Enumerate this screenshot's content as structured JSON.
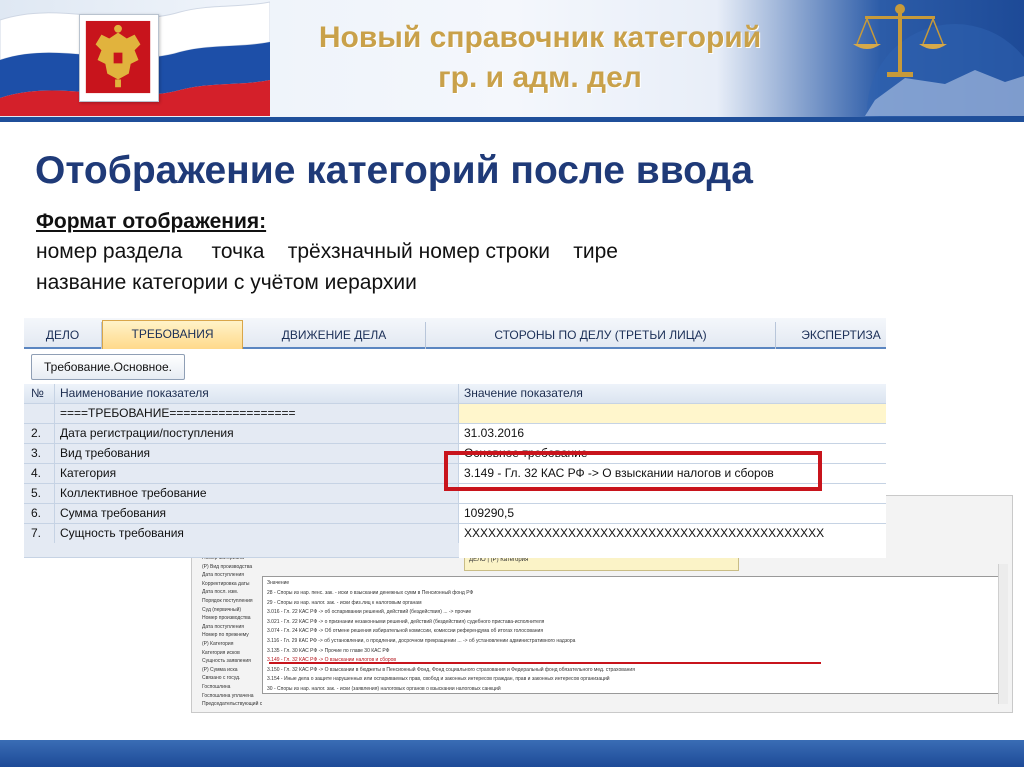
{
  "header": {
    "title_line1": "Новый справочник категорий",
    "title_line2": "гр. и адм. дел"
  },
  "heading": "Отображение категорий после ввода",
  "format": {
    "label": "Формат отображения:",
    "line1": "номер раздела     точка    трёхзначный номер строки    тире",
    "line2": "название категории с учётом иерархии"
  },
  "app": {
    "tabs": [
      {
        "label": "ДЕЛО",
        "active": false
      },
      {
        "label": "ТРЕБОВАНИЯ",
        "active": true
      },
      {
        "label": "ДВИЖЕНИЕ ДЕЛА",
        "active": false
      },
      {
        "label": "СТОРОНЫ ПО ДЕЛУ (ТРЕТЬИ ЛИЦА)",
        "active": false
      },
      {
        "label": "ЭКСПЕРТИЗА",
        "active": false
      }
    ],
    "button_label": "Требование.Основное.",
    "columns": [
      "№",
      "Наименование показателя",
      "Значение показателя"
    ],
    "rows": [
      {
        "num": "",
        "name": "====ТРЕБОВАНИЕ==================",
        "value": ""
      },
      {
        "num": "2.",
        "name": "Дата регистрации/поступления",
        "value": "31.03.2016"
      },
      {
        "num": "3.",
        "name": "Вид требования",
        "value": "Основное требование"
      },
      {
        "num": "4.",
        "name": "Категория",
        "value": "3.149 - Гл. 32 КАС РФ -> О взыскании налогов и сборов"
      },
      {
        "num": "5.",
        "name": "Коллективное требование",
        "value": ""
      },
      {
        "num": "6.",
        "name": "Сумма требования",
        "value": "109290,5"
      },
      {
        "num": "7.",
        "name": "Сущность требования",
        "value": "XXXXXXXXXXXXXXXXXXXXXXXXXXXXXXXXXXXXXXXXXXXXX"
      }
    ]
  },
  "background_window": {
    "left_rows": [
      "Номер материала",
      "(Р) Вид производства",
      "Дата поступления",
      "Корректировка даты",
      "Дата посл. изм.",
      "Порядок поступления",
      "Суд (первичный)",
      "Номер производства",
      "Дата поступления",
      "Номер по прежнему",
      "(Р) Категория",
      "Категория исков",
      "Сущность заявления",
      "(Р) Сумма иска",
      "Связано с госуд.",
      "Госпошлина",
      "Госпошлина уплачена",
      "Председательствующий судья"
    ],
    "top_field": "ДЕЛО | (Р) Категория",
    "dropdown_header": "Значение",
    "dropdown_rows": [
      "28 - Споры из нар. пенс. зак. - иски о взыскании денежных сумм в Пенсионный фонд РФ",
      "29 - Споры из нар. налог. зак. - иски физ.лиц к налоговым органам",
      "3.016 - Гл. 22 КАС РФ -> об оспаривании решений, действий (бездействия) ... -> прочие",
      "3.021 - Гл. 22 КАС РФ -> о признании незаконными решений, действий (бездействия) судебного пристава-исполнителя",
      "3.074 - Гл. 24 КАС РФ -> Об отмене решения избирательной комиссии, комиссии референдума об итогах голосования",
      "3.116 - Гл. 29 КАС РФ -> об установлении, о продлении, досрочном прекращении ... -> об установлении административного надзора",
      "3.135 - Гл. 30 КАС РФ -> Прочие по главе 30 КАС РФ",
      "3.149 - Гл. 32 КАС РФ -> О взыскании налогов и сборов",
      "3.150 - Гл. 32 КАС РФ -> О взыскании в бюджеты в Пенсионный Фонд, Фонд социального страхования и Федеральный фонд обязательного мед. страхования",
      "3.154 - Иные дела о защите нарушенных или оспариваемых прав, свобод и законных интересов граждан, прав и законных интересов организаций",
      "30 - Споры из нар. налог. зак. - иски (заявления) налоговых органов о взыскании налоговых санкций"
    ]
  }
}
